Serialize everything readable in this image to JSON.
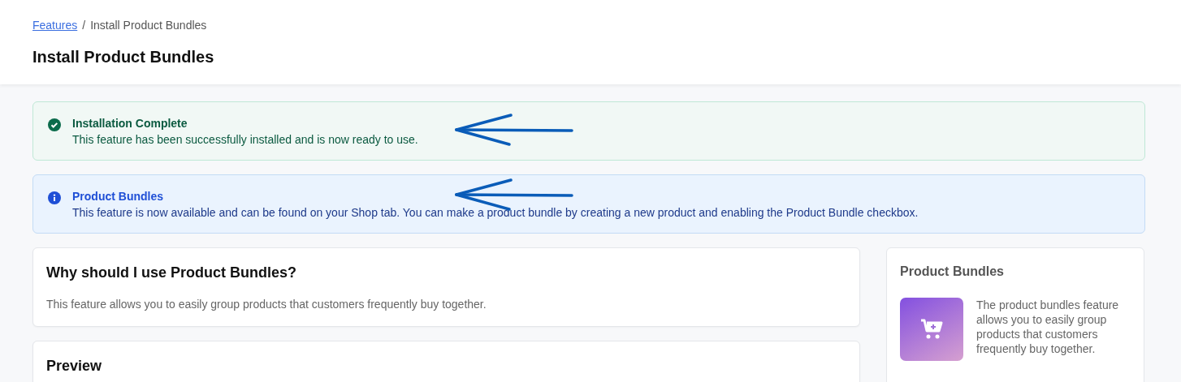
{
  "breadcrumb": {
    "link": "Features",
    "separator": "/",
    "current": "Install Product Bundles"
  },
  "page_title": "Install Product Bundles",
  "alerts": [
    {
      "kind": "success",
      "title": "Installation Complete",
      "text": "This feature has been successfully installed and is now ready to use.",
      "annotated": true
    },
    {
      "kind": "info",
      "title": "Product Bundles",
      "text": "This feature is now available and can be found on your Shop tab. You can make a product bundle by creating a new product and enabling the Product Bundle checkbox.",
      "annotated": true
    }
  ],
  "cards": [
    {
      "title": "Why should I use Product Bundles?",
      "text": "This feature allows you to easily group products that customers frequently buy together."
    },
    {
      "title": "Preview"
    }
  ],
  "sidebar": {
    "title": "Product Bundles",
    "text": "The product bundles feature allows you to easily group products that customers frequently buy together."
  }
}
